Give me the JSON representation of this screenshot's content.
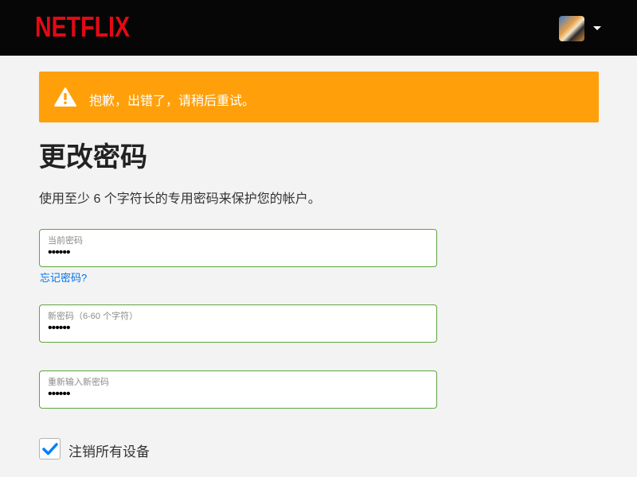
{
  "header": {
    "logo": "NETFLIX",
    "brand_color": "#e50914",
    "profile_icon": "avatar-tiger"
  },
  "alert": {
    "icon": "warning-icon",
    "message": "抱歉，出错了，请稍后重试。",
    "color": "#ffa00a"
  },
  "page_title": "更改密码",
  "description": "使用至少 6 个字符长的专用密码来保护您的帐户。",
  "fields": [
    {
      "label": "当前密码",
      "value": "••••••"
    },
    {
      "label": "新密码（6-60 个字符）",
      "value": "••••••"
    },
    {
      "label": "重新输入新密码",
      "value": "••••••"
    }
  ],
  "forgot_link": "忘记密码?",
  "signout_checkbox": {
    "label": "注销所有设备",
    "checked": true
  }
}
